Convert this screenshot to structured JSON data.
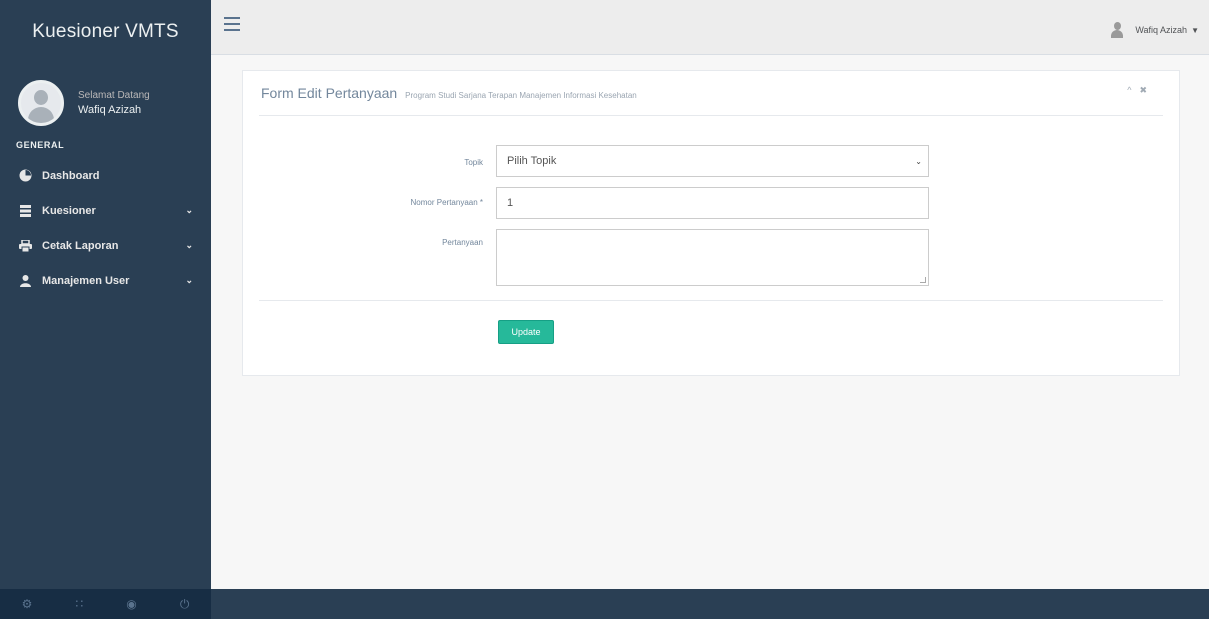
{
  "app": {
    "brand": "Kuesioner VMTS"
  },
  "sidebar": {
    "welcome": "Selamat Datang",
    "username": "Wafiq Azizah",
    "section": "GENERAL",
    "items": [
      {
        "label": "Dashboard",
        "icon": "dashboard-icon",
        "has_submenu": false
      },
      {
        "label": "Kuesioner",
        "icon": "list-icon",
        "has_submenu": true
      },
      {
        "label": "Cetak Laporan",
        "icon": "print-icon",
        "has_submenu": true
      },
      {
        "label": "Manajemen User",
        "icon": "user-icon",
        "has_submenu": true
      }
    ],
    "footer_icons": [
      "settings-icon",
      "fullscreen-icon",
      "lock-icon",
      "logout-icon"
    ]
  },
  "topnav": {
    "user_label": "Wafiq Azizah"
  },
  "panel": {
    "title": "Form Edit Pertanyaan",
    "subtitle": "Program Studi Sarjana Terapan Manajemen Informasi Kesehatan"
  },
  "form": {
    "topik_label": "Topik",
    "topik_value": "Pilih Topik",
    "nomor_label": "Nomor Pertanyaan *",
    "nomor_value": "1",
    "pertanyaan_label": "Pertanyaan",
    "pertanyaan_value": "",
    "update_label": "Update"
  },
  "colors": {
    "sidebar": "#2a3f54",
    "accent": "#26b99a",
    "topnav": "#ededed"
  }
}
